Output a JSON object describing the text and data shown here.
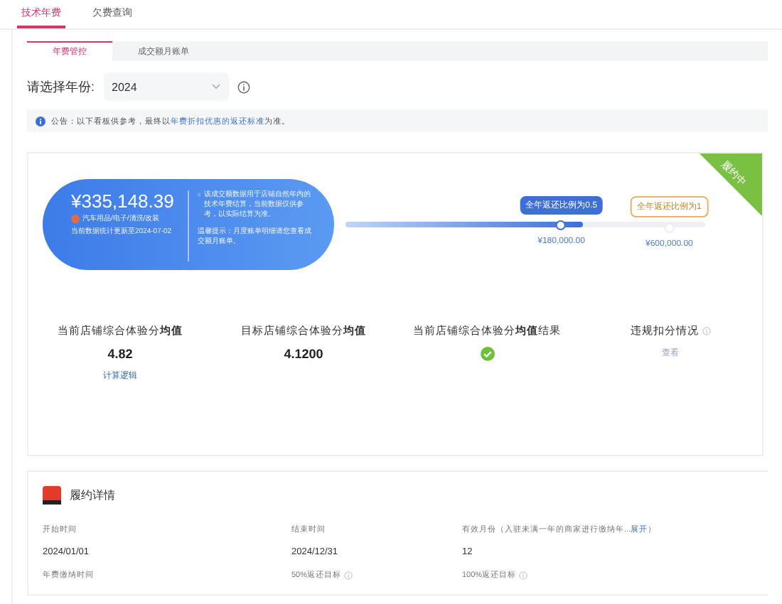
{
  "tabs": [
    {
      "label": "技术年费",
      "selected": true
    },
    {
      "label": "欠费查询",
      "selected": false
    }
  ],
  "subtabs": [
    {
      "label": "年费管控",
      "selected": true
    },
    {
      "label": "成交额月账单",
      "selected": false
    }
  ],
  "year_select": {
    "label": "请选择年份:",
    "value": "2024"
  },
  "notice": {
    "prefix": "公告：以下看板供参考，最终以",
    "link": "年费折扣优惠的返还标准",
    "suffix": "为准。"
  },
  "summary": {
    "amount": "¥335,148.39",
    "category": "汽车用品/电子/清洗/改装",
    "updated": "当前数据统计更新至2024-07-02",
    "note": "该成交额数据用于店铺自然年内的技术年费结算，当前数据仅供参考，以实际结算为准。",
    "tip": "温馨提示：月度账单明细请您查看成交额月账单。"
  },
  "progress": {
    "level": 0.66,
    "markers": [
      {
        "label": "全年返还比例为0.5",
        "amount": "¥180,000.00",
        "reached": true
      },
      {
        "label": "全年返还比例为1",
        "amount": "¥600,000.00",
        "reached": false
      }
    ]
  },
  "ribbon": "履约中",
  "metrics": [
    {
      "kind": "value",
      "label": "当前店铺综合体验分**均值**",
      "value": "4.82",
      "link": "计算逻辑"
    },
    {
      "kind": "value",
      "label": "目标店铺综合体验分**均值**",
      "value": "4.1200"
    },
    {
      "kind": "check",
      "label": "当前店铺综合体验分**均值**结果",
      "passed": true
    },
    {
      "kind": "link",
      "label": "违规扣分情况",
      "link": "查看",
      "info": true
    }
  ],
  "detail": {
    "title": "履约详情",
    "fields": [
      {
        "label": "开始时间",
        "value": "2024/01/01"
      },
      {
        "label": "结束时间",
        "value": "2024/12/31"
      },
      {
        "label": "有效月份（入驻未满一年的商家进行缴纳年...",
        "link": "展开",
        "suffix": "）",
        "value": "12"
      },
      {
        "label": "年费缴纳时间",
        "info": false
      },
      {
        "label": "50%返还目标",
        "info": true
      },
      {
        "label": "100%返还目标",
        "info": true
      }
    ]
  }
}
